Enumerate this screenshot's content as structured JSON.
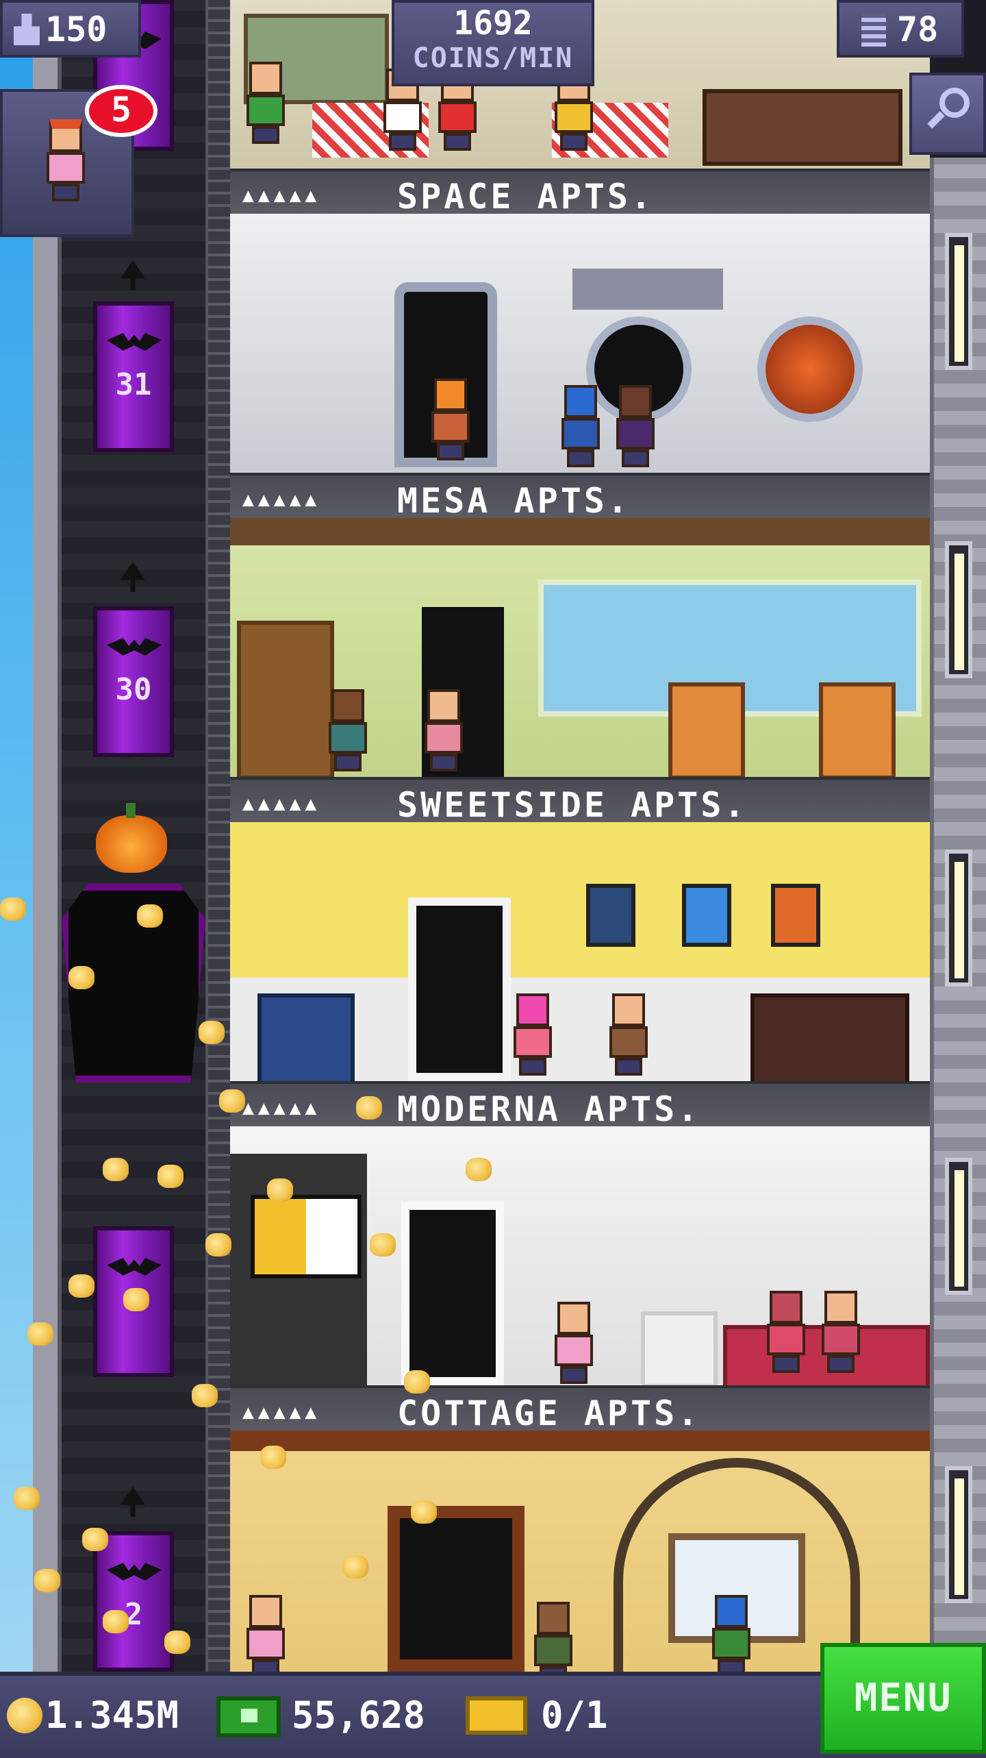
{
  "hud": {
    "population": "150",
    "coins_per_min_value": "1692",
    "coins_per_min_label": "COINS/MIN",
    "floors_count": "78",
    "visitor_badge": "5"
  },
  "elevator": {
    "floor_numbers": [
      "31",
      "30",
      "2"
    ]
  },
  "floors": [
    {
      "name": "SPACE APTS.",
      "pips": "▲▲▲▲▲"
    },
    {
      "name": "MESA APTS.",
      "pips": "▲▲▲▲▲"
    },
    {
      "name": "SWEETSIDE APTS.",
      "pips": "▲▲▲▲▲"
    },
    {
      "name": "MODERNA APTS.",
      "pips": "▲▲▲▲▲"
    },
    {
      "name": "COTTAGE APTS.",
      "pips": "▲▲▲▲▲"
    }
  ],
  "bottom_bar": {
    "coins": "1.345M",
    "tower_bux": "55,628",
    "vip": "0/1",
    "menu_label": "MENU"
  },
  "icons": [
    "population-icon",
    "floors-icon",
    "search-icon",
    "coin-icon",
    "bux-icon",
    "vip-icon"
  ],
  "colors": {
    "hud": "#4e4e7a",
    "menu": "#2ec82e",
    "badge": "#e8102a",
    "elevator_door": "#a32ae0"
  }
}
